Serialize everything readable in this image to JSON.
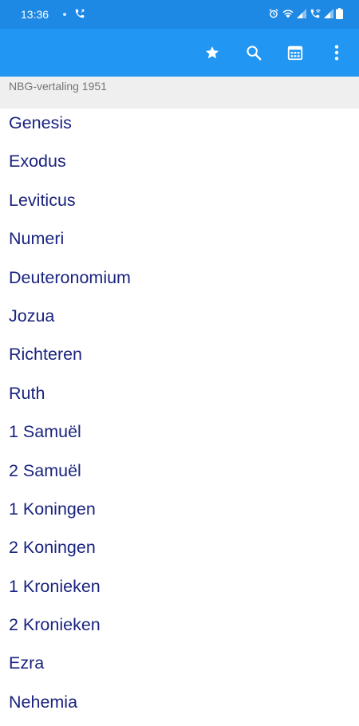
{
  "status_bar": {
    "time": "13:36",
    "icons": [
      "call-status-icon",
      "alarm-icon",
      "wifi-icon",
      "signal-icon",
      "wifi-calling-icon",
      "signal-icon",
      "battery-icon"
    ]
  },
  "toolbar": {
    "actions": [
      "star-icon",
      "search-icon",
      "calendar-icon",
      "more-vert-icon"
    ]
  },
  "header": {
    "version_label": "NBG-vertaling 1951"
  },
  "books": [
    {
      "label": "Genesis"
    },
    {
      "label": "Exodus"
    },
    {
      "label": "Leviticus"
    },
    {
      "label": "Numeri"
    },
    {
      "label": "Deuteronomium"
    },
    {
      "label": "Jozua"
    },
    {
      "label": "Richteren"
    },
    {
      "label": "Ruth"
    },
    {
      "label": "1 Samuël"
    },
    {
      "label": "2 Samuël"
    },
    {
      "label": "1 Koningen"
    },
    {
      "label": "2 Koningen"
    },
    {
      "label": "1 Kronieken"
    },
    {
      "label": "2 Kronieken"
    },
    {
      "label": "Ezra"
    },
    {
      "label": "Nehemia"
    }
  ],
  "colors": {
    "status_bar": "#1e88e5",
    "toolbar": "#2196f3",
    "header_bg": "#efefef",
    "header_text": "#757575",
    "book_text": "#1a237e"
  }
}
